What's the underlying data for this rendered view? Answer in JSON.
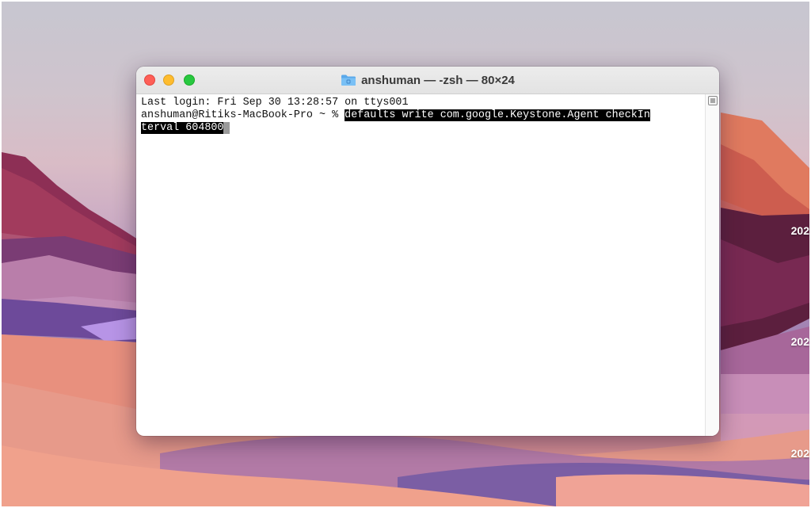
{
  "window": {
    "title": "anshuman — -zsh — 80×24"
  },
  "terminal": {
    "login_line": "Last login: Fri Sep 30 13:28:57 on ttys001",
    "prompt": "anshuman@Ritiks-MacBook-Pro ~ % ",
    "command_part1": "defaults write com.google.Keystone.Agent checkIn",
    "command_part2": "terval 604800"
  },
  "desktop": {
    "labels": [
      "202",
      "202",
      "202"
    ]
  },
  "colors": {
    "close": "#fe5f57",
    "minimize": "#febc2e",
    "zoom": "#28c840",
    "selection_bg": "#000000"
  },
  "icons": {
    "title_icon": "folder-icon",
    "scroll_icon": "menu-icon"
  }
}
